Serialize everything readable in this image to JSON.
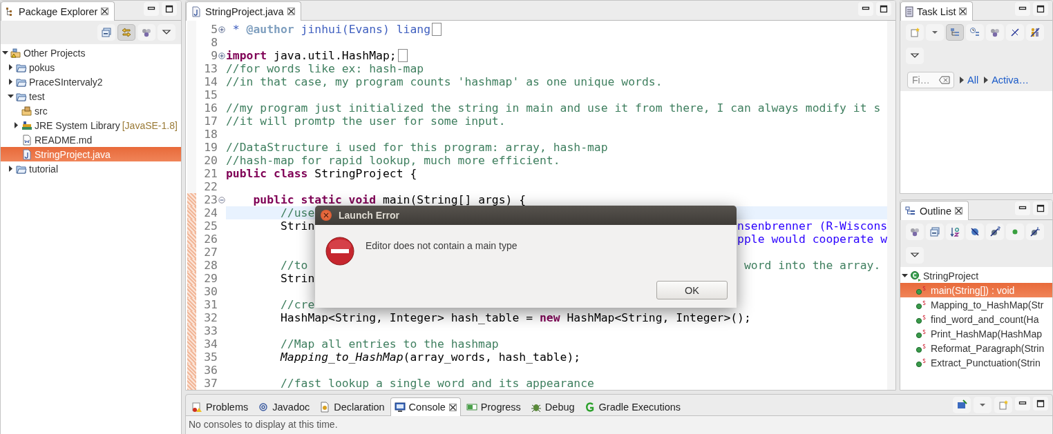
{
  "package_explorer": {
    "title": "Package Explorer",
    "toolbar": [
      {
        "kind": "collapse",
        "on": false
      },
      {
        "kind": "link",
        "on": true
      },
      {
        "kind": "filter",
        "on": false
      },
      {
        "kind": "menu",
        "on": false
      }
    ],
    "tree": [
      {
        "label": "Other Projects",
        "kind": "working-set",
        "expanded": true,
        "selected": false,
        "children": [
          {
            "label": "pokus",
            "kind": "project",
            "expanded": false,
            "selected": false
          },
          {
            "label": "PraceSIntervaly2",
            "kind": "project",
            "expanded": false,
            "selected": false
          },
          {
            "label": "test",
            "kind": "project",
            "expanded": true,
            "selected": false,
            "children": [
              {
                "label": "src",
                "kind": "source-folder",
                "selected": false
              },
              {
                "label": "JRE System Library",
                "suffix": "[JavaSE-1.8]",
                "kind": "library",
                "expanded": false,
                "selected": false
              },
              {
                "label": "README.md",
                "kind": "doc-file",
                "selected": false
              },
              {
                "label": "StringProject.java",
                "kind": "java-file",
                "selected": true
              }
            ]
          },
          {
            "label": "tutorial",
            "kind": "project",
            "expanded": false,
            "selected": false
          }
        ]
      }
    ]
  },
  "editor": {
    "tab": "StringProject.java",
    "lines": [
      {
        "number": "5",
        "folded": true,
        "current": false,
        "changed": false,
        "tokens": [
          {
            "kind": "javadoc",
            "text": " * "
          },
          {
            "kind": "tag",
            "text": "@author"
          },
          {
            "kind": "javadoc",
            "text": " jinhui(Evans) liang"
          }
        ]
      },
      {
        "number": "8",
        "current": false,
        "changed": false
      },
      {
        "number": "9",
        "folded": true,
        "current": false,
        "changed": false,
        "tokens": [
          {
            "kind": "keyword",
            "text": "import"
          },
          {
            "kind": "plain",
            "text": " java.util.HashMap;"
          }
        ]
      },
      {
        "number": "13",
        "current": false,
        "changed": false,
        "tokens": [
          {
            "kind": "comment",
            "text": "//for words like ex: hash-map"
          }
        ]
      },
      {
        "number": "14",
        "current": false,
        "changed": false,
        "tokens": [
          {
            "kind": "comment",
            "text": "//in that case, my program counts 'hashmap' as one unique words."
          }
        ]
      },
      {
        "number": "15",
        "current": false,
        "changed": false
      },
      {
        "number": "16",
        "current": false,
        "changed": false,
        "tokens": [
          {
            "kind": "comment",
            "text": "//my program just initialized the string in main and use it from there, I can always modify it s"
          }
        ]
      },
      {
        "number": "17",
        "current": false,
        "changed": false,
        "tokens": [
          {
            "kind": "comment",
            "text": "//it will promtp the user for some input."
          }
        ]
      },
      {
        "number": "18",
        "current": false,
        "changed": false
      },
      {
        "number": "19",
        "current": false,
        "changed": false,
        "tokens": [
          {
            "kind": "comment",
            "text": "//DataStructure i used for this program: array, hash-map"
          }
        ]
      },
      {
        "number": "20",
        "current": false,
        "changed": false,
        "tokens": [
          {
            "kind": "comment",
            "text": "//hash-map for rapid lookup, much more efficient."
          }
        ]
      },
      {
        "number": "21",
        "current": false,
        "changed": false,
        "tokens": [
          {
            "kind": "keyword",
            "text": "public class"
          },
          {
            "kind": "plain",
            "text": " StringProject {"
          }
        ]
      },
      {
        "number": "22",
        "current": false,
        "changed": false
      },
      {
        "number": "23",
        "folded": false,
        "current": false,
        "changed": true,
        "tokens": [
          {
            "kind": "keyword",
            "text": "    public static void"
          },
          {
            "kind": "plain",
            "text": " main(String[] args) {"
          }
        ]
      },
      {
        "number": "24",
        "current": true,
        "changed": true,
        "tokens": [
          {
            "kind": "comment",
            "text": "        //use"
          }
        ]
      },
      {
        "number": "25",
        "current": false,
        "changed": true,
        "tokens": [
          {
            "kind": "plain",
            "text": "        Strin"
          }
        ],
        "right": [
          {
            "kind": "string",
            "text": "nsenbrenner (R-Wiscons"
          }
        ]
      },
      {
        "number": "26",
        "current": false,
        "changed": true,
        "right": [
          {
            "kind": "string",
            "text": "pple would cooperate w"
          }
        ]
      },
      {
        "number": "27",
        "current": false,
        "changed": true
      },
      {
        "number": "28",
        "current": false,
        "changed": true,
        "tokens": [
          {
            "kind": "comment",
            "text": "        //to"
          }
        ],
        "right": [
          {
            "kind": "comment",
            "text": " word into the array."
          }
        ]
      },
      {
        "number": "29",
        "current": false,
        "changed": true,
        "tokens": [
          {
            "kind": "plain",
            "text": "        Strin"
          }
        ]
      },
      {
        "number": "30",
        "current": false,
        "changed": true
      },
      {
        "number": "31",
        "current": false,
        "changed": true,
        "tokens": [
          {
            "kind": "comment",
            "text": "        //cre"
          }
        ]
      },
      {
        "number": "32",
        "current": false,
        "changed": true,
        "tokens": [
          {
            "kind": "plain",
            "text": "        HashMap<String, Integer> hash_table = "
          },
          {
            "kind": "keyword",
            "text": "new"
          },
          {
            "kind": "plain",
            "text": " HashMap<String, Integer>();"
          }
        ]
      },
      {
        "number": "33",
        "current": false,
        "changed": true
      },
      {
        "number": "34",
        "current": false,
        "changed": true,
        "tokens": [
          {
            "kind": "comment",
            "text": "        //Map all entries to the hashmap"
          }
        ]
      },
      {
        "number": "35",
        "current": false,
        "changed": true,
        "tokens": [
          {
            "kind": "italic",
            "text": "        Mapping_to_HashMap"
          },
          {
            "kind": "plain",
            "text": "(array_words, hash_table);"
          }
        ]
      },
      {
        "number": "36",
        "current": false,
        "changed": true
      },
      {
        "number": "37",
        "current": false,
        "changed": true,
        "tokens": [
          {
            "kind": "comment",
            "text": "        //fast lookup a single word and its appearance"
          }
        ]
      }
    ]
  },
  "dialog": {
    "title": "Launch Error",
    "message": "Editor does not contain a main type",
    "button": "OK"
  },
  "task_list": {
    "title": "Task List",
    "toolbar": [
      {
        "kind": "new-task",
        "on": false
      },
      {
        "kind": "dropdown",
        "on": false
      },
      {
        "kind": "categorized",
        "on": true
      },
      {
        "kind": "scheduled",
        "on": false
      },
      {
        "kind": "filter",
        "on": false
      },
      {
        "kind": "hide-completed",
        "on": false
      },
      {
        "kind": "focus",
        "on": false
      }
    ],
    "filter_placeholder": "Fi…",
    "links": [
      "All",
      "Activa…"
    ]
  },
  "outline": {
    "title": "Outline",
    "toolbar": [
      {
        "kind": "filter",
        "on": false
      },
      {
        "kind": "collapse",
        "on": false
      },
      {
        "kind": "sort",
        "on": false
      },
      {
        "kind": "hide-fields",
        "on": false
      },
      {
        "kind": "hide-static",
        "on": false
      },
      {
        "kind": "hide-nonpublic",
        "on": false
      },
      {
        "kind": "hide-local",
        "on": false
      }
    ],
    "tree": [
      {
        "label": "StringProject",
        "kind": "class",
        "expanded": true,
        "selected": false,
        "children": [
          {
            "label": "main(String[]) : void",
            "kind": "method",
            "selected": true
          },
          {
            "label": "Mapping_to_HashMap(Str",
            "kind": "method",
            "selected": false
          },
          {
            "label": "find_word_and_count(Ha",
            "kind": "method",
            "selected": false
          },
          {
            "label": "Print_HashMap(HashMap",
            "kind": "method",
            "selected": false
          },
          {
            "label": "Reformat_Paragraph(Strin",
            "kind": "method",
            "selected": false
          },
          {
            "label": "Extract_Punctuation(Strin",
            "kind": "method",
            "selected": false
          }
        ]
      }
    ]
  },
  "bottom_panel": {
    "tabs": [
      {
        "label": "Problems",
        "kind": "problems",
        "selected": false
      },
      {
        "label": "Javadoc",
        "kind": "javadoc",
        "selected": false
      },
      {
        "label": "Declaration",
        "kind": "declaration",
        "selected": false
      },
      {
        "label": "Console",
        "kind": "console",
        "selected": true
      },
      {
        "label": "Progress",
        "kind": "progress",
        "selected": false
      },
      {
        "label": "Debug",
        "kind": "debug",
        "selected": false
      },
      {
        "label": "Gradle Executions",
        "kind": "gradle",
        "selected": false
      }
    ],
    "message": "No consoles to display at this time."
  }
}
